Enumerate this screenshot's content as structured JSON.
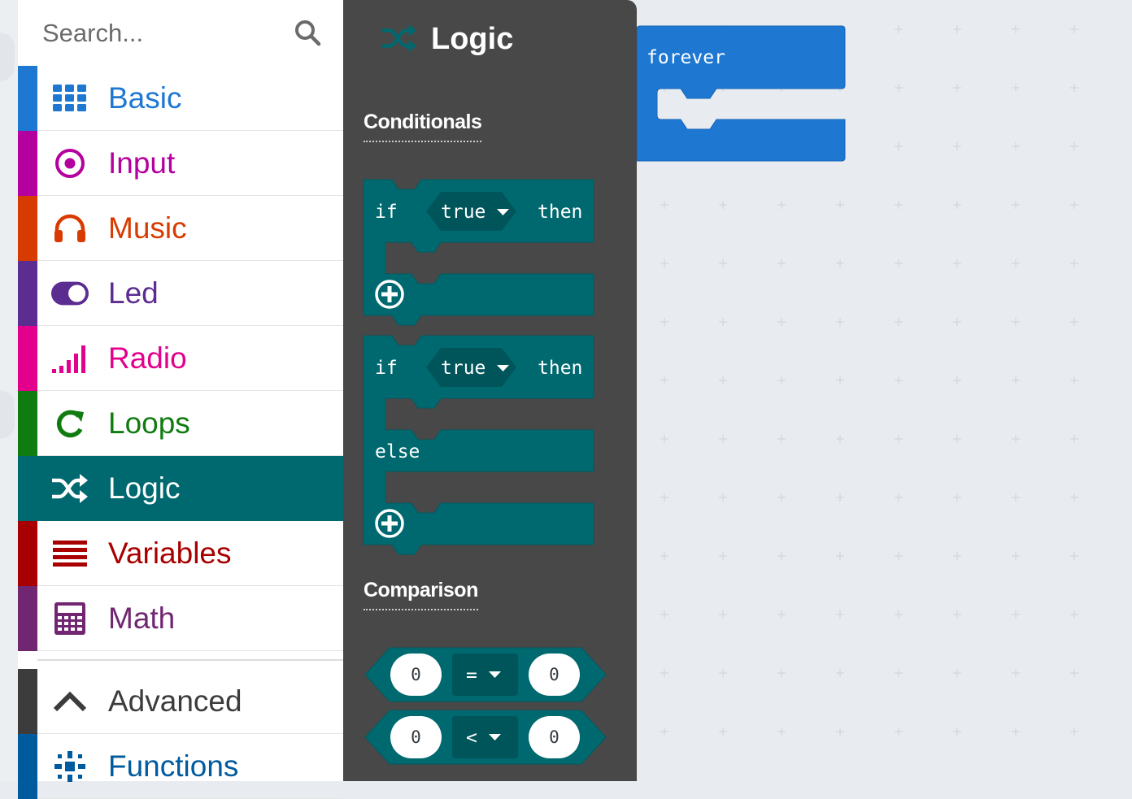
{
  "search": {
    "placeholder": "Search..."
  },
  "categories": [
    {
      "label": "Basic",
      "icon": "grid-icon",
      "color": "#1E78D2"
    },
    {
      "label": "Input",
      "icon": "target-icon",
      "color": "#B4009E"
    },
    {
      "label": "Music",
      "icon": "headphones-icon",
      "color": "#D83B01"
    },
    {
      "label": "Led",
      "icon": "toggle-icon",
      "color": "#5C2D91"
    },
    {
      "label": "Radio",
      "icon": "signal-bars-icon",
      "color": "#E3008C"
    },
    {
      "label": "Loops",
      "icon": "refresh-icon",
      "color": "#107C10"
    },
    {
      "label": "Logic",
      "icon": "shuffle-icon",
      "color": "#006970",
      "selected": true
    },
    {
      "label": "Variables",
      "icon": "list-lines-icon",
      "color": "#A80000"
    },
    {
      "label": "Math",
      "icon": "calculator-icon",
      "color": "#712672"
    },
    {
      "label": "Advanced",
      "icon": "chevron-up-icon",
      "color": "#3C3C3C"
    },
    {
      "label": "Functions",
      "icon": "functions-icon",
      "color": "#005A9E"
    }
  ],
  "flyout": {
    "title": "Logic",
    "icon": "shuffle-icon",
    "background": "#484848",
    "sections": {
      "conditionals": "Conditionals",
      "comparison": "Comparison"
    },
    "blocks": {
      "if_then": {
        "if": "if",
        "cond": "true",
        "then": "then"
      },
      "if_then_else": {
        "if": "if",
        "cond": "true",
        "then": "then",
        "else": "else"
      },
      "compare_eq": {
        "left": "0",
        "op": "=",
        "right": "0"
      },
      "compare_lt": {
        "left": "0",
        "op": "<",
        "right": "0"
      }
    },
    "block_color": "#006970"
  },
  "workspace": {
    "background": "#e8ebef",
    "forever_label": "forever",
    "forever_color": "#1E78D2"
  }
}
